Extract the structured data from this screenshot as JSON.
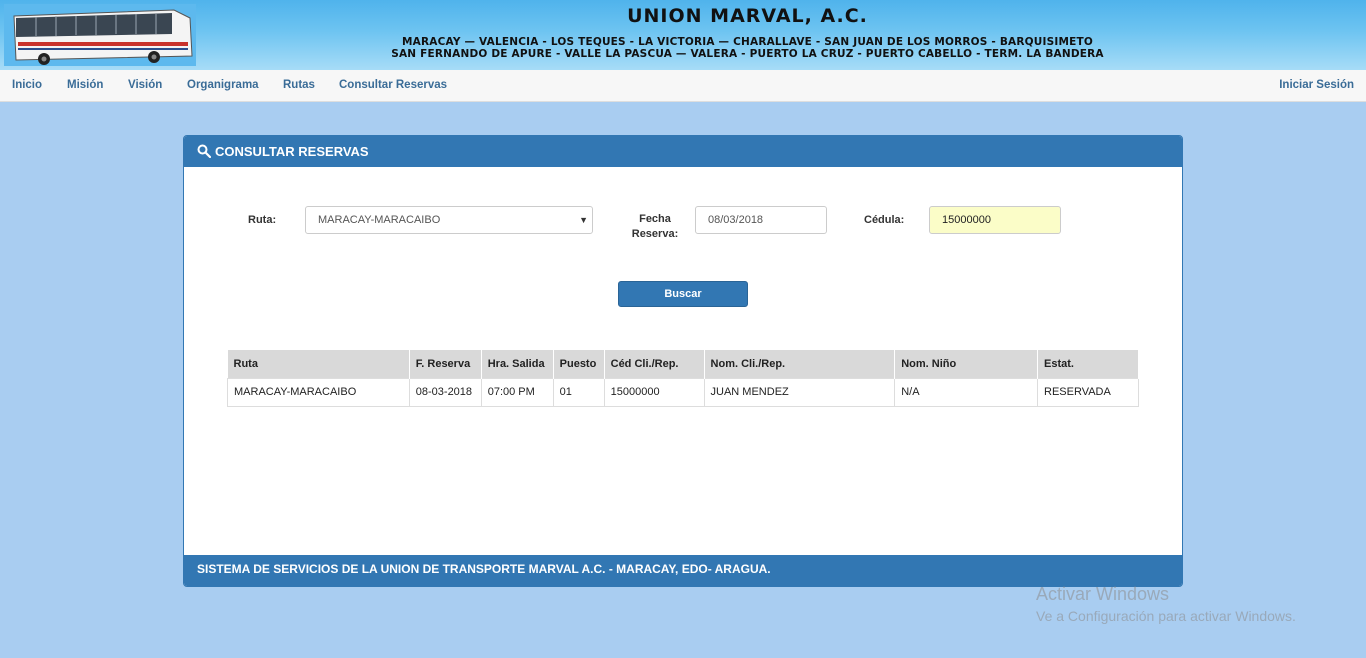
{
  "banner": {
    "title": "UNION MARVAL, A.C.",
    "routes_line1": "MARACAY — VALENCIA - LOS TEQUES - LA VICTORIA — CHARALLAVE - SAN JUAN DE LOS MORROS - BARQUISIMETO",
    "routes_line2": "SAN FERNANDO DE APURE - VALLE  LA PASCUA — VALERA - PUERTO LA CRUZ - PUERTO CABELLO - TERM. LA BANDERA"
  },
  "nav": {
    "items": [
      "Inicio",
      "Misión",
      "Visión",
      "Organigrama",
      "Rutas",
      "Consultar Reservas"
    ],
    "login": "Iniciar Sesión"
  },
  "panel": {
    "title": "CONSULTAR RESERVAS",
    "footer": "SISTEMA DE SERVICIOS DE LA UNION DE TRANSPORTE MARVAL A.C. - MARACAY, EDO- ARAGUA."
  },
  "form": {
    "ruta_label": "Ruta:",
    "ruta_value": "MARACAY-MARACAIBO",
    "fecha_label_1": "Fecha",
    "fecha_label_2": "Reserva:",
    "fecha_value": "08/03/2018",
    "cedula_label": "Cédula:",
    "cedula_value": "15000000",
    "search_button": "Buscar"
  },
  "table": {
    "headers": [
      "Ruta",
      "F. Reserva",
      "Hra. Salida",
      "Puesto",
      "Céd Cli./Rep.",
      "Nom. Cli./Rep.",
      "Nom. Niño",
      "Estat."
    ],
    "rows": [
      [
        "MARACAY-MARACAIBO",
        "08-03-2018",
        "07:00 PM",
        "01",
        "15000000",
        "JUAN MENDEZ",
        "N/A",
        "RESERVADA"
      ]
    ]
  },
  "watermark": {
    "line1": "Activar Windows",
    "line2": "Ve a Configuración para activar Windows."
  }
}
